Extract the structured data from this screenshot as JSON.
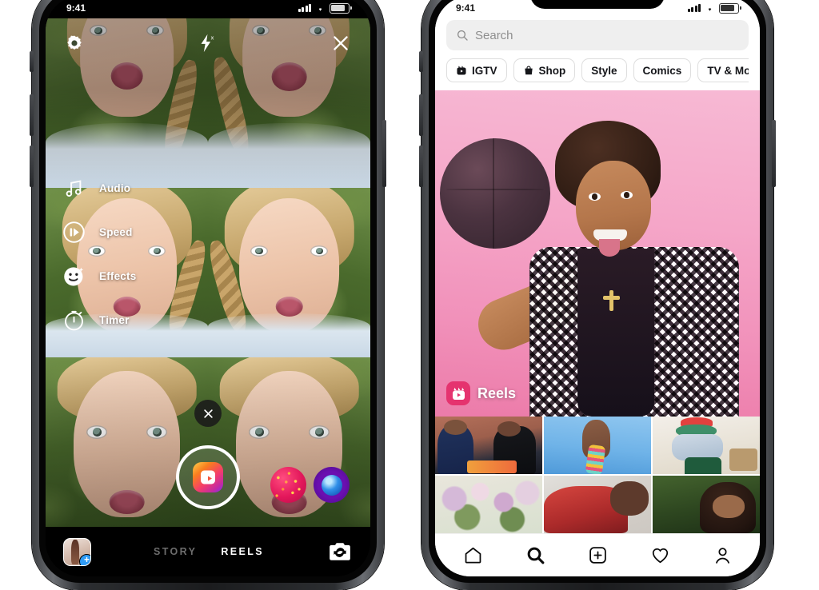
{
  "scene": {
    "description": "Two smartphone mockups side by side showing Instagram Reels camera and Explore page",
    "background_color": "#ffffff"
  },
  "left_phone": {
    "statusbar": {
      "time": "9:41",
      "carrier_bars": 4,
      "battery": "72%"
    },
    "camera": {
      "top_controls": [
        {
          "name": "settings-icon",
          "label": "Settings"
        },
        {
          "name": "flash-off-icon",
          "label": "Flash off"
        },
        {
          "name": "close-icon",
          "label": "Close"
        }
      ],
      "tools": [
        {
          "icon": "audio-icon",
          "label": "Audio"
        },
        {
          "icon": "speed-icon",
          "label": "Speed"
        },
        {
          "icon": "effects-icon",
          "label": "Effects"
        },
        {
          "icon": "timer-icon",
          "label": "Timer"
        }
      ],
      "dismiss_label": "×",
      "shutter": {
        "name": "reels-shutter-button",
        "label": "Record"
      },
      "effect_thumbs": [
        {
          "name": "effect-hearts",
          "color": "#e3175b"
        },
        {
          "name": "effect-orb",
          "color": "#6a0fb0"
        }
      ]
    },
    "bottom": {
      "gallery_label": "Gallery",
      "add_badge": "+",
      "modes": [
        {
          "label": "STORY",
          "active": false
        },
        {
          "label": "REELS",
          "active": true
        }
      ],
      "flip_label": "Flip camera"
    }
  },
  "right_phone": {
    "statusbar": {
      "time": "9:41",
      "carrier_bars": 4,
      "battery": "72%"
    },
    "search": {
      "placeholder": "Search",
      "value": ""
    },
    "chips": [
      {
        "label": "IGTV",
        "icon": "igtv-icon"
      },
      {
        "label": "Shop",
        "icon": "shop-bag-icon"
      },
      {
        "label": "Style",
        "icon": ""
      },
      {
        "label": "Comics",
        "icon": ""
      },
      {
        "label": "TV & Movies",
        "icon": ""
      }
    ],
    "hero": {
      "label": "Reels",
      "badge_color": "#e5336f",
      "background_color": "#f5a6c8",
      "alt": "Person spinning a basketball on finger against pink backdrop"
    },
    "grid": [
      {
        "name": "grid-cell-1",
        "alt": "Two people at a table writing in a notebook"
      },
      {
        "name": "grid-cell-2",
        "alt": "Hand with glittery nails against blue sky"
      },
      {
        "name": "grid-cell-3",
        "alt": "Person in denim jacket and beanie"
      },
      {
        "name": "grid-cell-4",
        "alt": "Floral arrangement"
      },
      {
        "name": "grid-cell-5",
        "alt": "Red fabric close up"
      },
      {
        "name": "grid-cell-6",
        "alt": "Person outdoors with greenery"
      }
    ],
    "tabbar": [
      {
        "name": "tab-home",
        "label": "Home",
        "active": false
      },
      {
        "name": "tab-search",
        "label": "Search",
        "active": true
      },
      {
        "name": "tab-create",
        "label": "Create",
        "active": false
      },
      {
        "name": "tab-activity",
        "label": "Activity",
        "active": false
      },
      {
        "name": "tab-profile",
        "label": "Profile",
        "active": false
      }
    ]
  }
}
